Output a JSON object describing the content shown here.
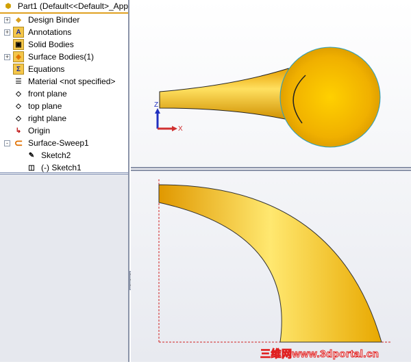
{
  "tree": {
    "title": "Part1  (Default<<Default>_App",
    "items": [
      {
        "label": "Design Binder",
        "expander": "+",
        "icon": "design-binder-icon"
      },
      {
        "label": "Annotations",
        "expander": "+",
        "icon": "annotations-folder-icon"
      },
      {
        "label": "Solid Bodies",
        "expander": "",
        "icon": "solid-bodies-folder-icon"
      },
      {
        "label": "Surface Bodies(1)",
        "expander": "+",
        "icon": "surface-bodies-folder-icon"
      },
      {
        "label": "Equations",
        "expander": "",
        "icon": "equations-folder-icon"
      },
      {
        "label": "Material <not specified>",
        "expander": "",
        "icon": "material-icon"
      },
      {
        "label": "front plane",
        "expander": "",
        "icon": "plane-icon"
      },
      {
        "label": "top plane",
        "expander": "",
        "icon": "plane-icon"
      },
      {
        "label": "right plane",
        "expander": "",
        "icon": "plane-icon"
      },
      {
        "label": "Origin",
        "expander": "",
        "icon": "origin-icon"
      },
      {
        "label": "Surface-Sweep1",
        "expander": "-",
        "icon": "sweep-icon"
      }
    ],
    "children": [
      {
        "label": "Sketch2"
      },
      {
        "label": "(-) Sketch1"
      }
    ]
  },
  "triad": {
    "z": "Z",
    "x": "X"
  },
  "watermark": "三维网www.3dportal.cn"
}
